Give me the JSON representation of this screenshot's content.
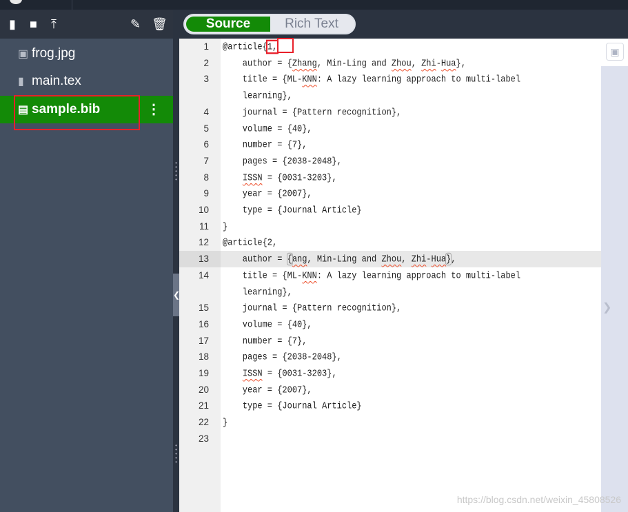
{
  "toolbar": {
    "icons": [
      "new-file-icon",
      "new-folder-icon",
      "upload-icon",
      "pencil-icon",
      "trash-icon"
    ]
  },
  "files": [
    {
      "name": "frog.jpg",
      "icon": "image-icon"
    },
    {
      "name": "main.tex",
      "icon": "file-icon"
    },
    {
      "name": "sample.bib",
      "icon": "book-icon",
      "active": true
    }
  ],
  "mode_toggle": {
    "source": "Source",
    "rich_text": "Rich Text",
    "selected": "Source"
  },
  "editor": {
    "current_line": 13,
    "rows": [
      {
        "n": "1",
        "segs": [
          {
            "t": "@article{"
          },
          {
            "t": "1,",
            "mark": true
          }
        ]
      },
      {
        "n": "2",
        "segs": [
          {
            "t": "    author = {"
          },
          {
            "t": "Zhang",
            "sp": true
          },
          {
            "t": ", Min-Ling and "
          },
          {
            "t": "Zhou",
            "sp": true
          },
          {
            "t": ", "
          },
          {
            "t": "Zhi",
            "sp": true
          },
          {
            "t": "-"
          },
          {
            "t": "Hua",
            "sp": true
          },
          {
            "t": "},"
          }
        ]
      },
      {
        "n": "3",
        "segs": [
          {
            "t": "    title = {ML-"
          },
          {
            "t": "KNN",
            "sp": true
          },
          {
            "t": ": A lazy learning approach to multi-label"
          }
        ]
      },
      {
        "n": "",
        "segs": [
          {
            "t": "    learning},"
          }
        ]
      },
      {
        "n": "4",
        "segs": [
          {
            "t": "    journal = {Pattern recognition},"
          }
        ]
      },
      {
        "n": "5",
        "segs": [
          {
            "t": "    volume = {40},"
          }
        ]
      },
      {
        "n": "6",
        "segs": [
          {
            "t": "    number = {7},"
          }
        ]
      },
      {
        "n": "7",
        "segs": [
          {
            "t": "    pages = {2038-2048},"
          }
        ]
      },
      {
        "n": "8",
        "segs": [
          {
            "t": "    "
          },
          {
            "t": "ISSN",
            "sp": true
          },
          {
            "t": " = {0031-3203},"
          }
        ]
      },
      {
        "n": "9",
        "segs": [
          {
            "t": "    year = {2007},"
          }
        ]
      },
      {
        "n": "10",
        "segs": [
          {
            "t": "    type = {Journal Article}"
          }
        ]
      },
      {
        "n": "11",
        "segs": [
          {
            "t": "}"
          }
        ]
      },
      {
        "n": "12",
        "segs": [
          {
            "t": "@article{2,"
          }
        ]
      },
      {
        "n": "13",
        "cur": true,
        "segs": [
          {
            "t": "    author = "
          },
          {
            "t": "{",
            "match": true
          },
          {
            "t": "ang",
            "sp": true
          },
          {
            "t": ", Min-Ling and "
          },
          {
            "t": "Zhou",
            "sp": true
          },
          {
            "t": ", "
          },
          {
            "t": "Zhi",
            "sp": true
          },
          {
            "t": "-"
          },
          {
            "t": "Hua",
            "sp": true
          },
          {
            "t": "}",
            "match": true
          },
          {
            "t": ","
          }
        ]
      },
      {
        "n": "14",
        "segs": [
          {
            "t": "    title = {ML-"
          },
          {
            "t": "KNN",
            "sp": true
          },
          {
            "t": ": A lazy learning approach to multi-label"
          }
        ]
      },
      {
        "n": "",
        "segs": [
          {
            "t": "    learning},"
          }
        ]
      },
      {
        "n": "15",
        "segs": [
          {
            "t": "    journal = {Pattern recognition},"
          }
        ]
      },
      {
        "n": "16",
        "segs": [
          {
            "t": "    volume = {40},"
          }
        ]
      },
      {
        "n": "17",
        "segs": [
          {
            "t": "    number = {7},"
          }
        ]
      },
      {
        "n": "18",
        "segs": [
          {
            "t": "    pages = {2038-2048},"
          }
        ]
      },
      {
        "n": "19",
        "segs": [
          {
            "t": "    "
          },
          {
            "t": "ISSN",
            "sp": true
          },
          {
            "t": " = {0031-3203},"
          }
        ]
      },
      {
        "n": "20",
        "segs": [
          {
            "t": "    year = {2007},"
          }
        ]
      },
      {
        "n": "21",
        "segs": [
          {
            "t": "    type = {Journal Article}"
          }
        ]
      },
      {
        "n": "22",
        "segs": [
          {
            "t": "}"
          }
        ]
      },
      {
        "n": "23",
        "segs": [
          {
            "t": ""
          }
        ]
      }
    ]
  },
  "watermark": "https://blog.csdn.net/weixin_45808526",
  "colors": {
    "accent": "#138a07",
    "highlight": "#e8202a",
    "sidebar": "#434f60"
  }
}
